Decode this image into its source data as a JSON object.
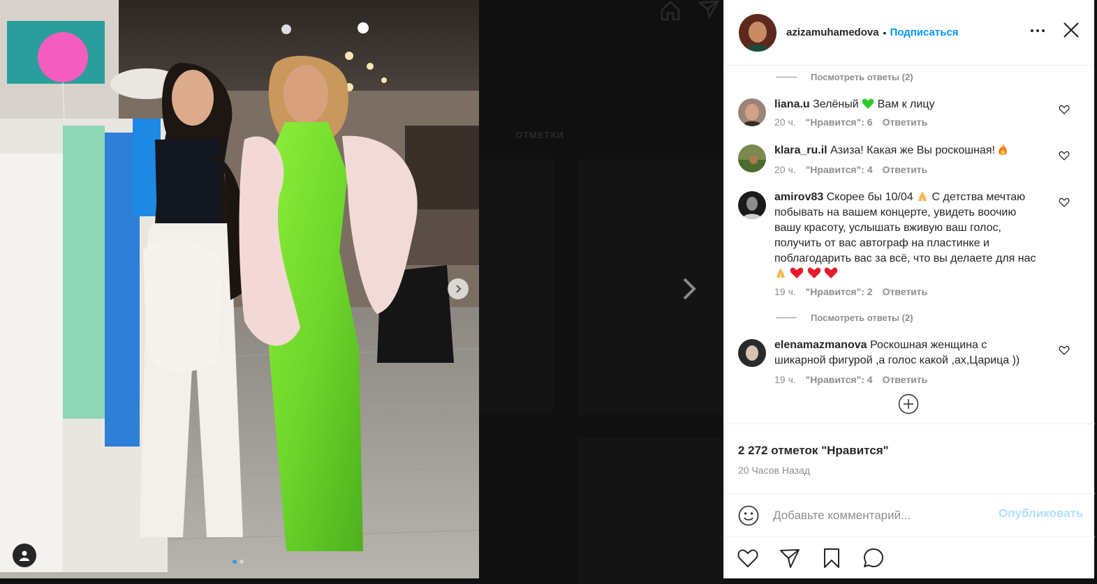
{
  "post": {
    "username": "azizamuhamedova",
    "separator": "•",
    "follow_label": "Подписаться",
    "carousel": {
      "slide_count": 2,
      "active_index": 0
    }
  },
  "background_page": {
    "tagged_tab": "ОТМЕТКИ"
  },
  "comments": {
    "view_replies_top": "Посмотреть ответы (2)",
    "view_replies_mid": "Посмотреть ответы (2)",
    "items": [
      {
        "user": "liana.u",
        "text_before": "Зелёный",
        "emoji": "green-heart",
        "text_after": "Вам к лицу",
        "time": "20 ч.",
        "likes": "\"Нравится\": 6",
        "reply": "Ответить"
      },
      {
        "user": "klara_ru.il",
        "text_before": "Азиза! Какая же Вы роскошная!",
        "emoji": "fire",
        "text_after": "",
        "time": "20 ч.",
        "likes": "\"Нравится\": 4",
        "reply": "Ответить"
      },
      {
        "user": "amirov83",
        "text_line1_a": "Скорее бы 10/04",
        "text_line1_b": "С детства мечтаю",
        "text_line2": "побывать на вашем концерте, увидеть воочию",
        "text_line3": "вашу красоту, услышать вживую ваш голос,",
        "text_line4": "получить от вас автограф на пластинке и",
        "text_line5": "поблагодарить вас за всё, что вы делаете для нас",
        "time": "19 ч.",
        "likes": "\"Нравится\": 2",
        "reply": "Ответить"
      },
      {
        "user": "elenamazmanova",
        "text_line1": "Роскошная женщина с",
        "text_line2": "шикарной фигурой ,а голос какой ,ах,Царица ))",
        "time": "19 ч.",
        "likes": "\"Нравится\": 4",
        "reply": "Ответить"
      }
    ]
  },
  "stats": {
    "likes": "2 272 отметок \"Нравится\"",
    "time": "20 Часов Назад"
  },
  "composer": {
    "placeholder": "Добавьте комментарий...",
    "publish_label": "Опубликовать"
  },
  "icons": [
    "home-icon",
    "direct-icon",
    "more-icon",
    "close-icon",
    "heart-icon",
    "share-icon",
    "bookmark-icon",
    "comment-icon",
    "smile-icon",
    "plus-circle-icon",
    "chevron-right-icon",
    "user-tag-icon"
  ],
  "colors": {
    "follow": "#0095f6",
    "publish_disabled": "#b2dffc",
    "muted": "#8e8e8e",
    "text": "#262626",
    "dress_green": "#6fd82b"
  }
}
